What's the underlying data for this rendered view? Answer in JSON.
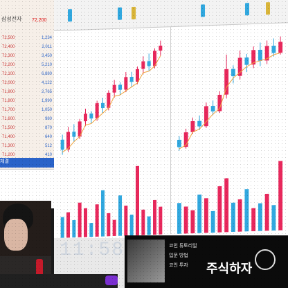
{
  "left_panel": {
    "title": "삼성전자",
    "price": "72,200",
    "rows": [
      {
        "a": "72,500",
        "b": "1,234"
      },
      {
        "a": "72,400",
        "b": "2,011"
      },
      {
        "a": "72,300",
        "b": "3,450"
      },
      {
        "a": "72,200",
        "b": "5,210"
      },
      {
        "a": "72,100",
        "b": "6,880"
      },
      {
        "a": "72,000",
        "b": "4,122"
      },
      {
        "a": "71,900",
        "b": "2,765"
      },
      {
        "a": "71,800",
        "b": "1,990"
      },
      {
        "a": "71,700",
        "b": "1,050"
      },
      {
        "a": "71,600",
        "b": "980"
      },
      {
        "a": "71,500",
        "b": "870"
      },
      {
        "a": "71,400",
        "b": "640"
      },
      {
        "a": "71,300",
        "b": "512"
      },
      {
        "a": "71,200",
        "b": "410"
      }
    ],
    "blue_bar_label": "체결"
  },
  "clock": "11:58",
  "ad": {
    "line1": "코인 튜토리얼",
    "line2": "입문 방법",
    "line3": "코인 투자",
    "big": "주식하자",
    "colors": {
      "bg": "#0b0b0b"
    }
  },
  "colors": {
    "up": "#e8285c",
    "down": "#31a8df",
    "ma": "#f0a23a"
  },
  "chart_data": [
    {
      "type": "bar",
      "title": "",
      "candles": [
        {
          "o": 52,
          "c": 48,
          "h": 54,
          "l": 46
        },
        {
          "o": 48,
          "c": 55,
          "h": 57,
          "l": 47
        },
        {
          "o": 55,
          "c": 53,
          "h": 58,
          "l": 51
        },
        {
          "o": 53,
          "c": 59,
          "h": 60,
          "l": 52
        },
        {
          "o": 59,
          "c": 62,
          "h": 64,
          "l": 57
        },
        {
          "o": 62,
          "c": 60,
          "h": 63,
          "l": 58
        },
        {
          "o": 60,
          "c": 66,
          "h": 67,
          "l": 59
        },
        {
          "o": 66,
          "c": 64,
          "h": 68,
          "l": 62
        },
        {
          "o": 64,
          "c": 70,
          "h": 71,
          "l": 63
        },
        {
          "o": 70,
          "c": 73,
          "h": 75,
          "l": 68
        },
        {
          "o": 73,
          "c": 71,
          "h": 74,
          "l": 69
        },
        {
          "o": 71,
          "c": 76,
          "h": 78,
          "l": 70
        },
        {
          "o": 76,
          "c": 74,
          "h": 78,
          "l": 72
        },
        {
          "o": 74,
          "c": 79,
          "h": 80,
          "l": 73
        },
        {
          "o": 79,
          "c": 82,
          "h": 84,
          "l": 77
        },
        {
          "o": 82,
          "c": 80,
          "h": 85,
          "l": 78
        },
        {
          "o": 80,
          "c": 86,
          "h": 87,
          "l": 79
        },
        {
          "o": 86,
          "c": 88,
          "h": 90,
          "l": 84
        }
      ],
      "volume": [
        18,
        22,
        15,
        30,
        25,
        12,
        28,
        40,
        20,
        14,
        35,
        26,
        18,
        60,
        22,
        16,
        30,
        24
      ]
    },
    {
      "type": "bar",
      "title": "",
      "candles": [
        {
          "o": 40,
          "c": 36,
          "h": 42,
          "l": 34
        },
        {
          "o": 36,
          "c": 44,
          "h": 46,
          "l": 35
        },
        {
          "o": 44,
          "c": 50,
          "h": 52,
          "l": 43
        },
        {
          "o": 50,
          "c": 47,
          "h": 53,
          "l": 45
        },
        {
          "o": 47,
          "c": 58,
          "h": 60,
          "l": 46
        },
        {
          "o": 58,
          "c": 55,
          "h": 61,
          "l": 53
        },
        {
          "o": 55,
          "c": 64,
          "h": 66,
          "l": 54
        },
        {
          "o": 64,
          "c": 78,
          "h": 86,
          "l": 62
        },
        {
          "o": 78,
          "c": 74,
          "h": 80,
          "l": 70
        },
        {
          "o": 74,
          "c": 84,
          "h": 88,
          "l": 72
        },
        {
          "o": 84,
          "c": 80,
          "h": 86,
          "l": 76
        },
        {
          "o": 80,
          "c": 88,
          "h": 90,
          "l": 78
        },
        {
          "o": 88,
          "c": 82,
          "h": 92,
          "l": 79
        },
        {
          "o": 82,
          "c": 90,
          "h": 93,
          "l": 80
        },
        {
          "o": 90,
          "c": 86,
          "h": 94,
          "l": 84
        },
        {
          "o": 86,
          "c": 92,
          "h": 95,
          "l": 85
        }
      ],
      "volume": [
        40,
        35,
        30,
        50,
        45,
        28,
        60,
        70,
        38,
        42,
        55,
        30,
        36,
        48,
        33,
        90
      ]
    }
  ]
}
